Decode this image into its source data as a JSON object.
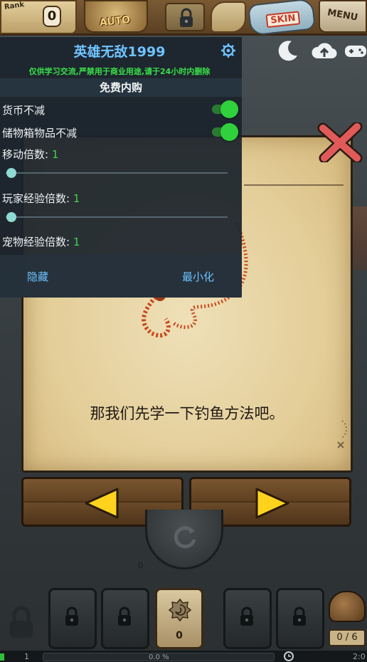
{
  "topbar": {
    "rank_label": "Rank",
    "rank_value": "0",
    "auto_label": "AUTO",
    "skin_label": "SKIN",
    "menu_label": "MENU"
  },
  "corner_icons": [
    "moon-icon",
    "cloud-upload-icon",
    "gamepad-icon"
  ],
  "overlay": {
    "title": "英雄无敌1999",
    "notice": "仅供学习交流,严禁用于商业用途,请于24小时内删除",
    "section": "免费内购",
    "toggles": [
      {
        "label": "货币不减",
        "on": true
      },
      {
        "label": "储物箱物品不减",
        "on": true
      }
    ],
    "sliders": [
      {
        "label": "移动倍数: ",
        "value": "1",
        "has_slider": true
      },
      {
        "label": "玩家经验倍数: ",
        "value": "1",
        "has_slider": true
      },
      {
        "label": "宠物经验倍数: ",
        "value": "1",
        "has_slider": false
      }
    ],
    "hide_button": "隐藏",
    "minimize_button": "最小化",
    "accent_color": "#6ec3ff",
    "green_color": "#39e04a"
  },
  "dialog": {
    "message": "那我们先学一下钓鱼方法吧。"
  },
  "wheel": {
    "label": "0"
  },
  "inventory": {
    "active_slot_count": "0",
    "capacity": "0 / 6"
  },
  "statusbar": {
    "level": "1",
    "exp_progress": "0.0 %",
    "time": "2:0"
  }
}
